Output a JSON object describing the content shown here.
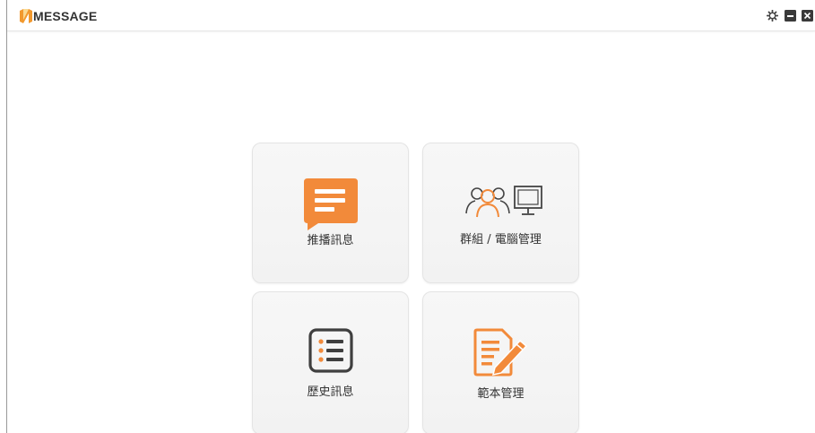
{
  "app": {
    "title": "MESSAGE",
    "logo_color": "#f2992e",
    "accent": "#f28a3a"
  },
  "titlebar": {
    "controls": [
      {
        "name": "settings",
        "icon": "gear-icon"
      },
      {
        "name": "minimize",
        "icon": "minimize-icon"
      },
      {
        "name": "close",
        "icon": "close-icon"
      }
    ]
  },
  "tiles": [
    {
      "label": "推播訊息",
      "icon": "chat-bubble-icon"
    },
    {
      "label": "群組 / 電腦管理",
      "icon": "group-computer-icon"
    },
    {
      "label": "歷史訊息",
      "icon": "list-icon"
    },
    {
      "label": "範本管理",
      "icon": "document-edit-icon"
    }
  ]
}
